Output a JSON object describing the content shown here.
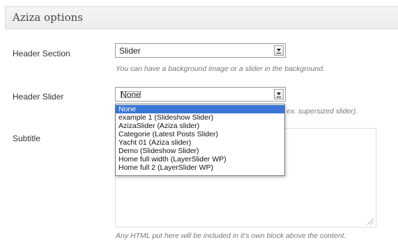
{
  "panel": {
    "title": "Aziza options"
  },
  "header_section": {
    "label": "Header Section",
    "value": "Slider",
    "help": "You can have a background image or a slider in the background."
  },
  "header_slider": {
    "label": "Header Slider",
    "value": "None",
    "help_fragment": "ex. supersized slider).",
    "options": [
      "None",
      "example 1 (Slideshow Slider)",
      "AzizaSlider (Aziza slider)",
      "Categorie (Latest Posts Slider)",
      "Yacht 01 (Aziza slider)",
      "Demo (Slideshow Slider)",
      "Home full width (LayerSlider WP)",
      "Home full 2 (LayerSlider WP)"
    ],
    "highlighted_option": "None"
  },
  "subtitle": {
    "label": "Subtitle",
    "help": "Any HTML put here will be included in it's own block above the content."
  },
  "colors": {
    "highlight": "#3875d7"
  }
}
